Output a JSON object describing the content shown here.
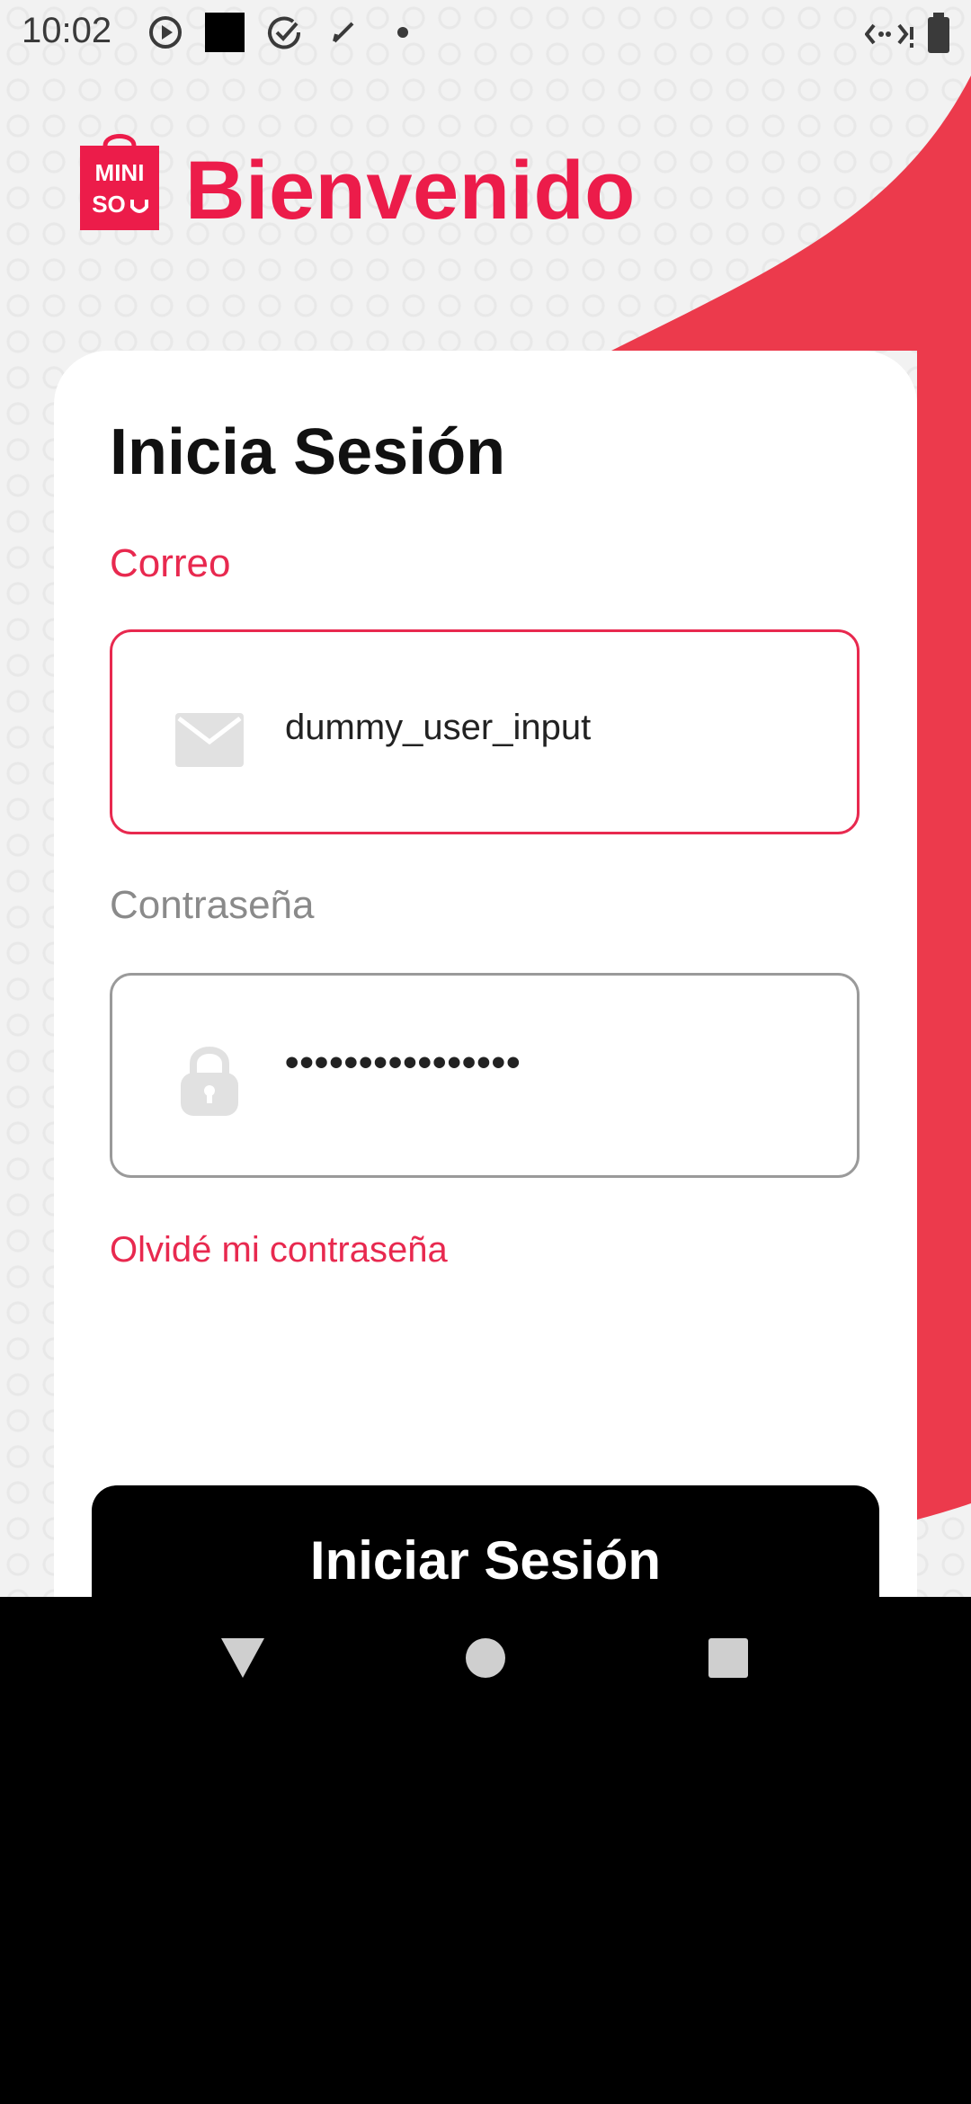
{
  "status_bar": {
    "time": "10:02",
    "icons": [
      "play-circle-icon",
      "black-square-icon",
      "check-circle-icon",
      "pen-icon",
      "dot-icon",
      "wifi-arrows-icon",
      "battery-icon"
    ]
  },
  "header": {
    "logo_lines": [
      "MINI",
      "SO"
    ],
    "title": "Bienvenido",
    "accent_color": "#ec1c4a"
  },
  "login_card": {
    "title": "Inicia Sesión",
    "email": {
      "label": "Correo",
      "value": "dummy_user_input",
      "icon": "mail-icon"
    },
    "password": {
      "label": "Contraseña",
      "value": "••••••••••••••••",
      "icon": "lock-icon"
    },
    "forgot_link": "Olvidé mi contraseña",
    "submit_label": "Iniciar Sesión"
  },
  "nav_bar": {
    "buttons": [
      "back-icon",
      "home-icon",
      "recents-icon"
    ]
  }
}
